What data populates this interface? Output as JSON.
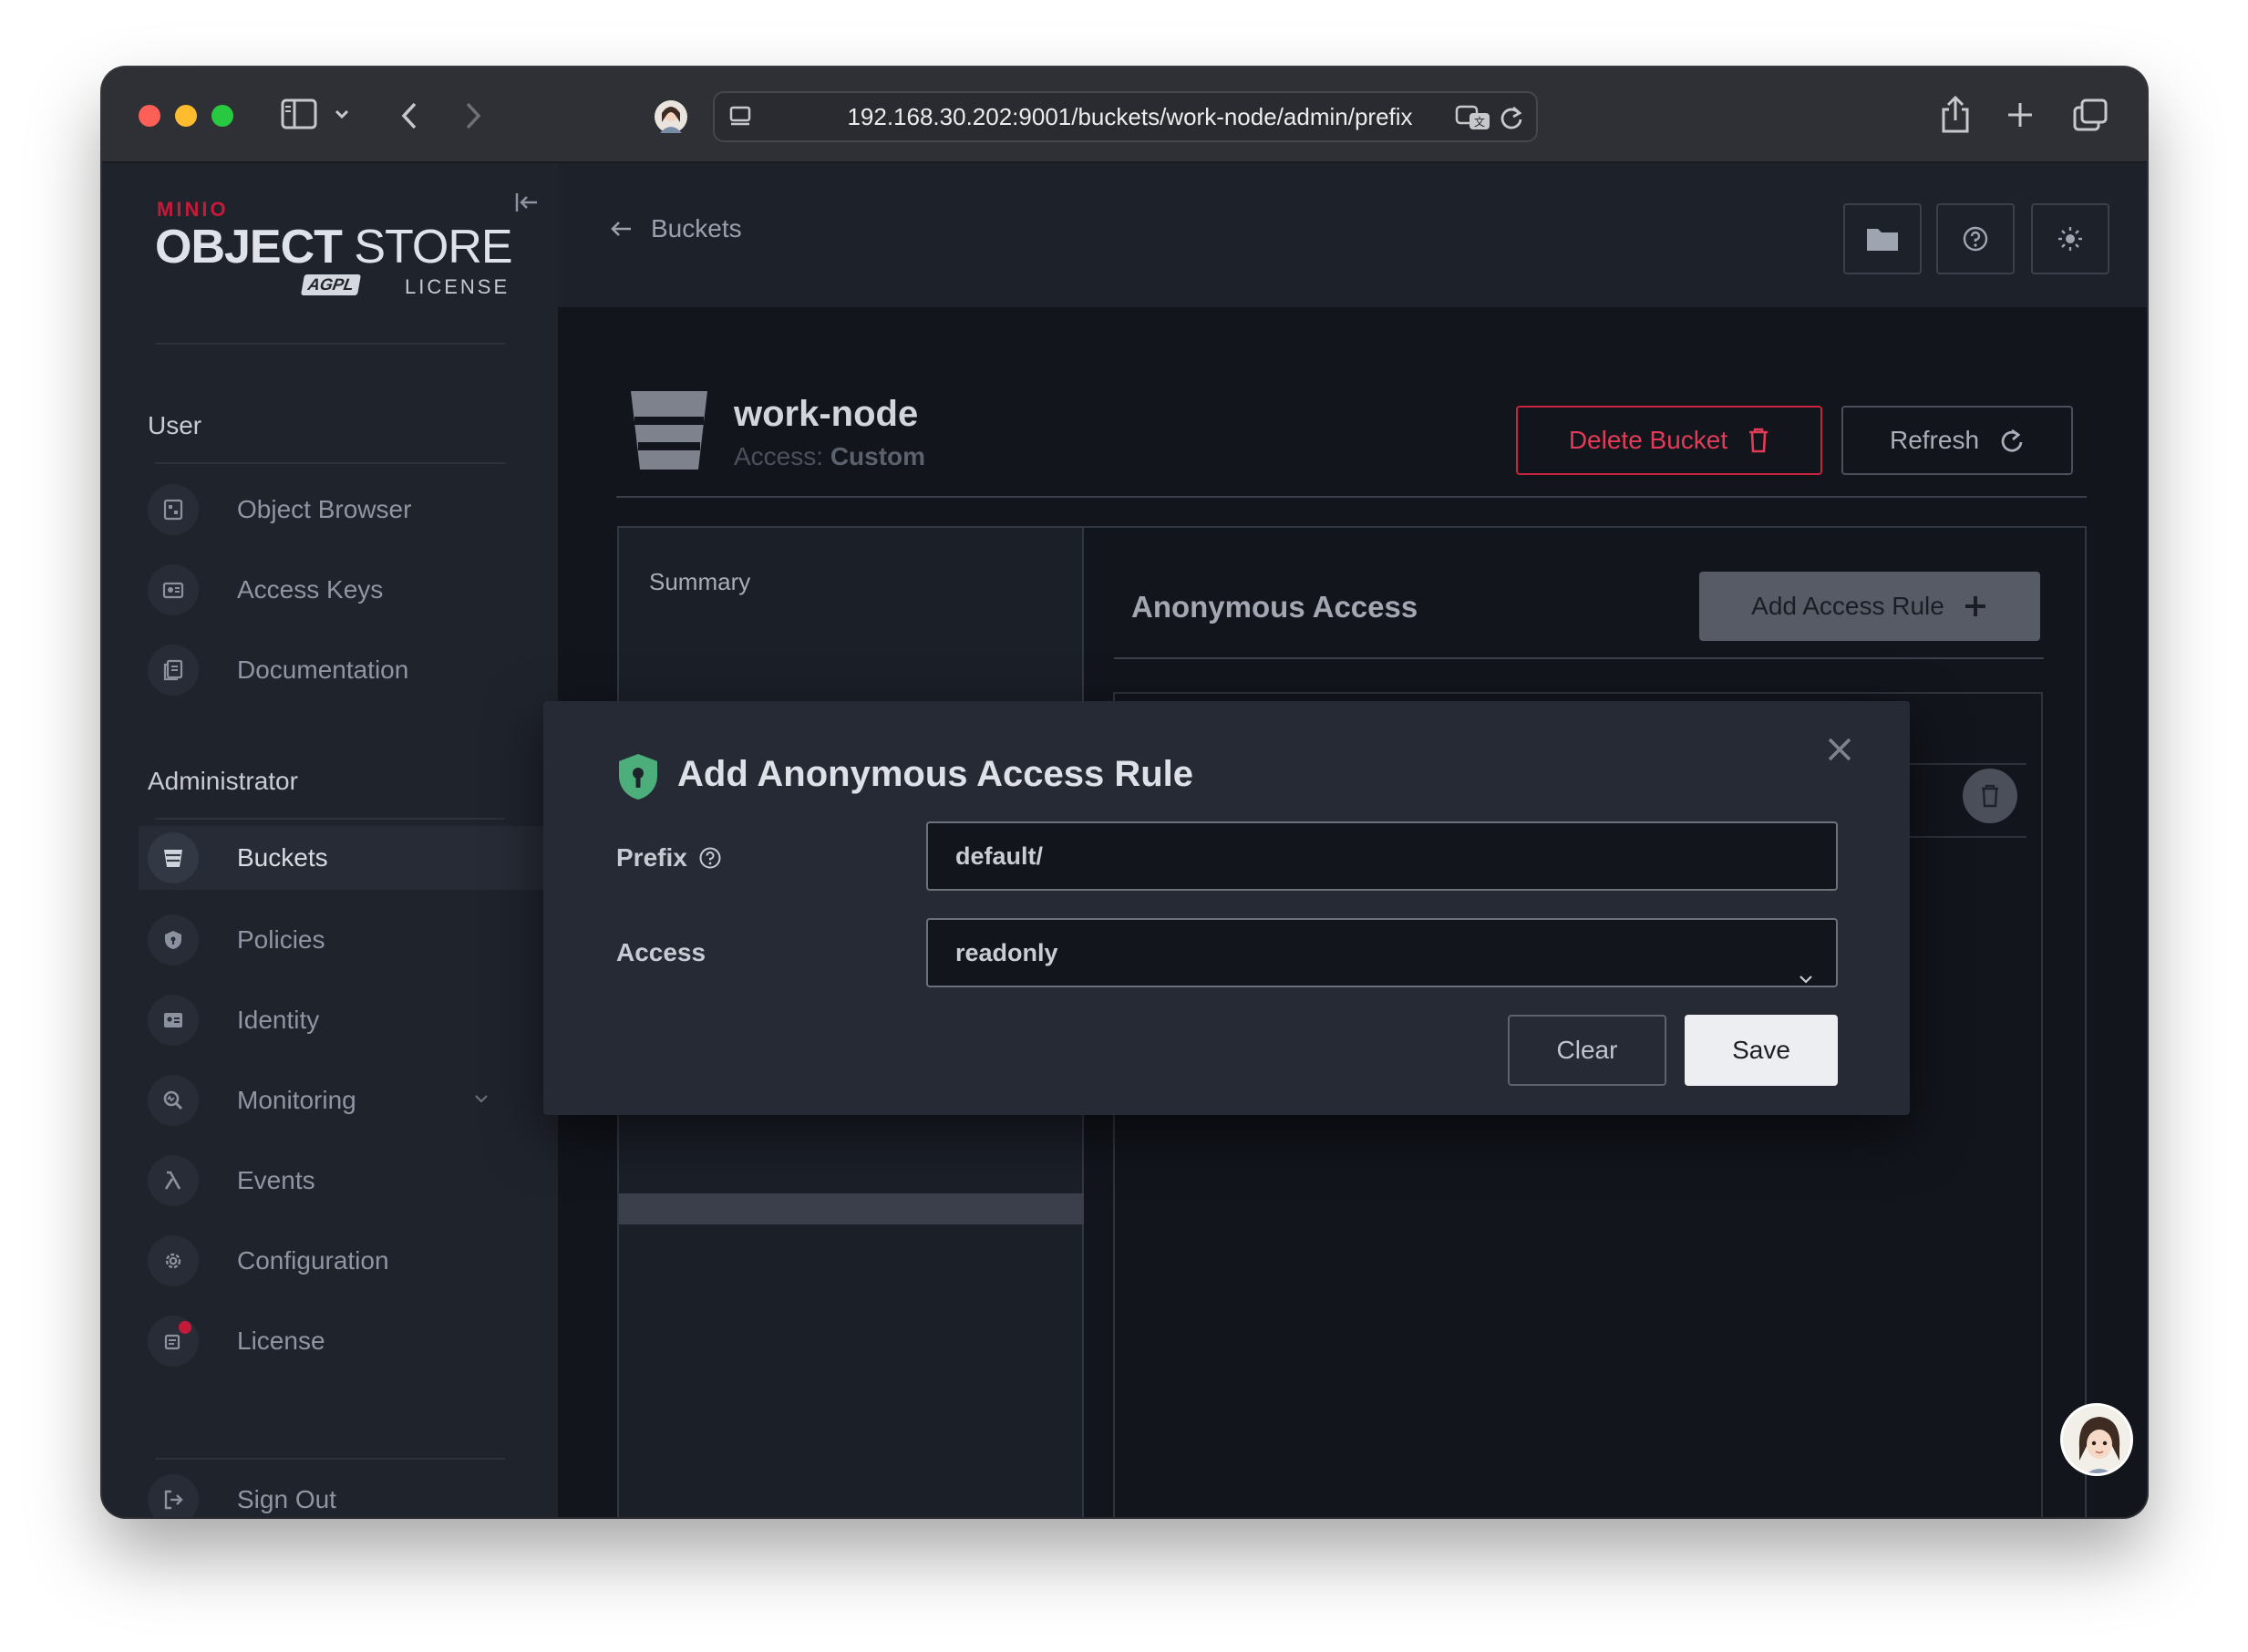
{
  "browser": {
    "url": "192.168.30.202:9001/buckets/work-node/admin/prefix"
  },
  "logo": {
    "brand": "MINIO",
    "product_bold": "OBJECT",
    "product_light": "STORE",
    "license_badge": "AGPL",
    "license_text": "LICENSE"
  },
  "sidebar": {
    "user_section": "User",
    "user_items": [
      {
        "label": "Object Browser",
        "icon": "object-browser-icon"
      },
      {
        "label": "Access Keys",
        "icon": "access-keys-icon"
      },
      {
        "label": "Documentation",
        "icon": "documentation-icon"
      }
    ],
    "admin_section": "Administrator",
    "admin_items": [
      {
        "label": "Buckets",
        "icon": "bucket-icon",
        "active": true
      },
      {
        "label": "Policies",
        "icon": "policies-icon"
      },
      {
        "label": "Identity",
        "icon": "identity-icon"
      },
      {
        "label": "Monitoring",
        "icon": "monitoring-icon"
      },
      {
        "label": "Events",
        "icon": "lambda-icon"
      },
      {
        "label": "Configuration",
        "icon": "gear-icon"
      },
      {
        "label": "License",
        "icon": "license-icon"
      }
    ],
    "sign_out": "Sign Out"
  },
  "header": {
    "back_label": "Buckets"
  },
  "bucket": {
    "name": "work-node",
    "access_label": "Access:",
    "access_value": "Custom",
    "delete_label": "Delete Bucket",
    "refresh_label": "Refresh"
  },
  "tabs": {
    "summary": "Summary"
  },
  "anonymous": {
    "title": "Anonymous Access",
    "add_rule_label": "Add Access Rule"
  },
  "modal": {
    "title": "Add Anonymous Access Rule",
    "prefix_label": "Prefix",
    "prefix_value": "default/",
    "access_label": "Access",
    "access_value": "readonly",
    "clear_label": "Clear",
    "save_label": "Save"
  },
  "colors": {
    "accent_red": "#c8233f",
    "shield_green": "#4cae7a",
    "background": "#12151c"
  }
}
